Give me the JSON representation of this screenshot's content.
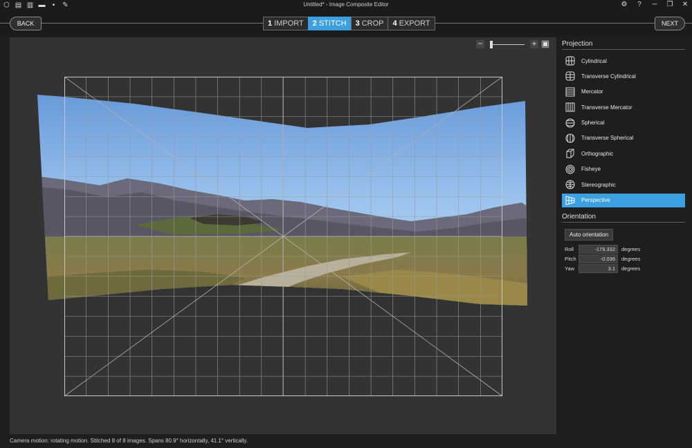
{
  "window": {
    "title": "Untitled* - Image Composite Editor"
  },
  "titlebar_tools": [
    "new-panorama-icon",
    "new-video-panorama-icon",
    "open-project-icon",
    "open-folder-icon",
    "save-icon",
    "export-icon"
  ],
  "window_controls": {
    "settings_icon": "gear-icon",
    "help": "?",
    "minimize": "─",
    "restore": "❐",
    "close": "✕"
  },
  "nav": {
    "back": "BACK",
    "next": "NEXT"
  },
  "steps": [
    {
      "num": "1",
      "label": "IMPORT"
    },
    {
      "num": "2",
      "label": "STITCH"
    },
    {
      "num": "3",
      "label": "CROP"
    },
    {
      "num": "4",
      "label": "EXPORT"
    }
  ],
  "active_step": 1,
  "zoom": {
    "minus": "−",
    "plus": "+"
  },
  "status_text": "Camera motion: rotating motion. Stitched 8 of 8 images. Spans 80.9° horizontally, 41.1° vertically.",
  "projection": {
    "title": "Projection",
    "items": [
      {
        "label": "Cylindrical",
        "icon": "cylindrical-icon"
      },
      {
        "label": "Transverse Cylindrical",
        "icon": "transverse-cylindrical-icon"
      },
      {
        "label": "Mercator",
        "icon": "mercator-icon"
      },
      {
        "label": "Transverse Mercator",
        "icon": "transverse-mercator-icon"
      },
      {
        "label": "Spherical",
        "icon": "spherical-icon"
      },
      {
        "label": "Transverse Spherical",
        "icon": "transverse-spherical-icon"
      },
      {
        "label": "Orthographic",
        "icon": "orthographic-icon"
      },
      {
        "label": "Fisheye",
        "icon": "fisheye-icon"
      },
      {
        "label": "Stereographic",
        "icon": "stereographic-icon"
      },
      {
        "label": "Perspective",
        "icon": "perspective-icon"
      }
    ],
    "selected": "Perspective"
  },
  "orientation": {
    "title": "Orientation",
    "auto_button": "Auto orientation",
    "roll": {
      "label": "Roll",
      "value": "-179.332",
      "unit": "degrees"
    },
    "pitch": {
      "label": "Pitch",
      "value": "-0.036",
      "unit": "degrees"
    },
    "yaw": {
      "label": "Yaw",
      "value": "3.1",
      "unit": "degrees"
    }
  },
  "colors": {
    "accent": "#3c9fe0",
    "background": "#1b1b1b",
    "canvas": "#333333"
  }
}
